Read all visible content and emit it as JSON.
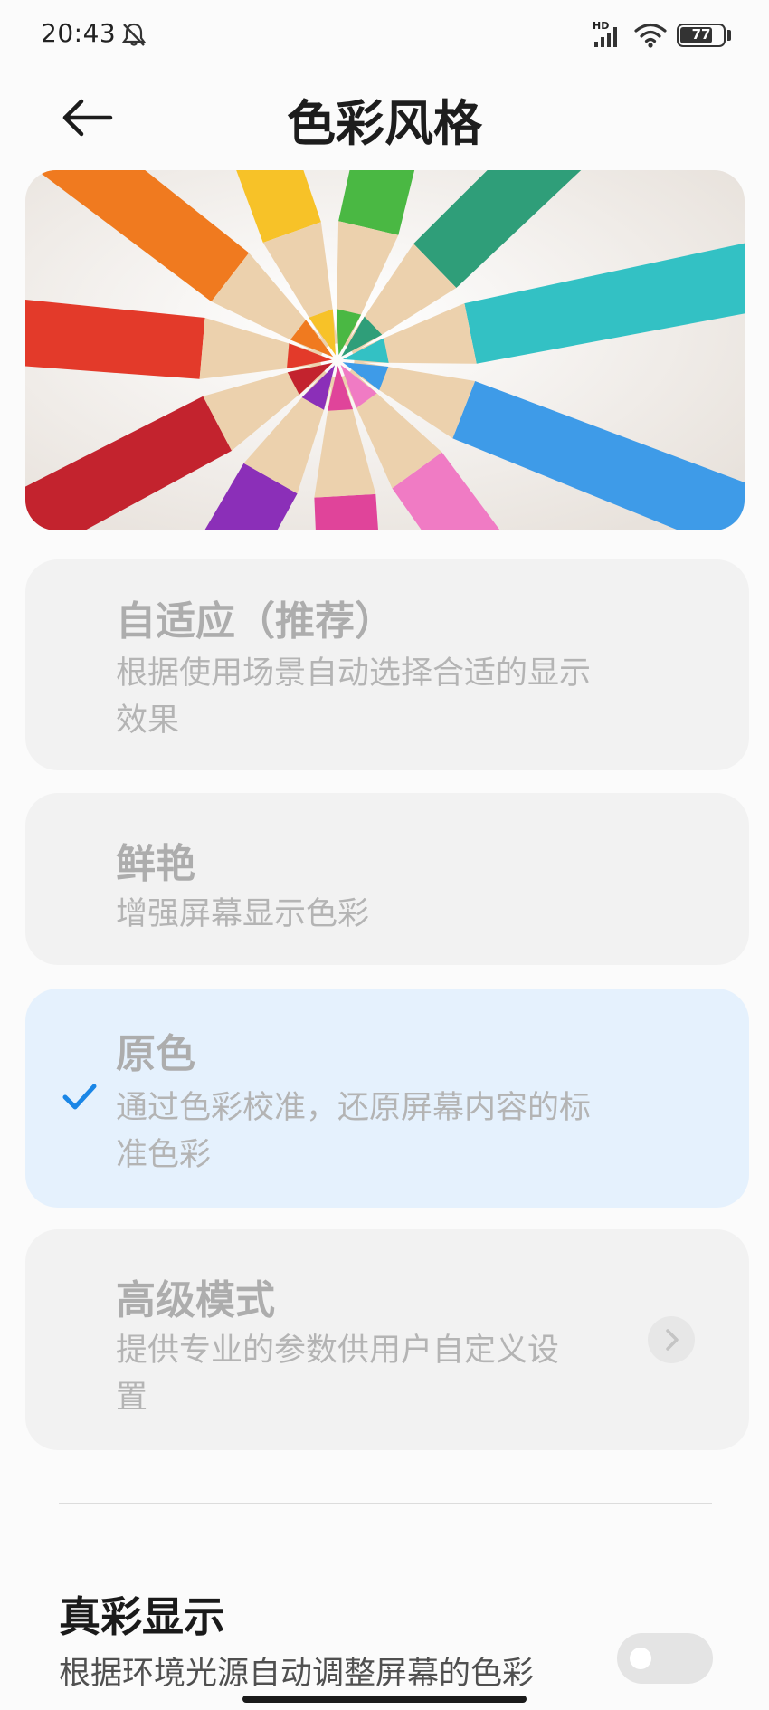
{
  "status_bar": {
    "time": "20:43",
    "network_label": "HD",
    "battery_level": "77",
    "battery_fraction": 0.77,
    "icons": [
      "bell-off-icon",
      "signal-icon",
      "wifi-icon",
      "battery-icon"
    ]
  },
  "header": {
    "title": "色彩风格",
    "back_icon": "back-arrow-icon"
  },
  "banner": {
    "image": "colored-pencils-image",
    "pencil_colors": [
      "#e33a2a",
      "#f07a1f",
      "#f7c228",
      "#4ab843",
      "#2f9e79",
      "#33c1c4",
      "#3e9be8",
      "#f07bc4",
      "#e0449a",
      "#8b2fb8",
      "#c3232e"
    ]
  },
  "options": [
    {
      "title": "自适应（推荐）",
      "desc_lines": [
        "根据使用场景自动选择合适的显示",
        "效果"
      ],
      "selected": false
    },
    {
      "title": "鲜艳",
      "desc_lines": [
        "增强屏幕显示色彩"
      ],
      "selected": false
    },
    {
      "title": "原色",
      "desc_lines": [
        "通过色彩校准，还原屏幕内容的标",
        "准色彩"
      ],
      "selected": true,
      "icon": "check-icon"
    },
    {
      "title": "高级模式",
      "desc_lines": [
        "提供专业的参数供用户自定义设",
        "置"
      ],
      "selected": false,
      "icon": "chevron-right-icon"
    }
  ],
  "true_color": {
    "title": "真彩显示",
    "desc": "根据环境光源自动调整屏幕的色彩",
    "enabled": false
  },
  "colors": {
    "selected_bg": "#e5f1fd",
    "card_bg": "#f2f2f2",
    "accent": "#1a86e6"
  }
}
